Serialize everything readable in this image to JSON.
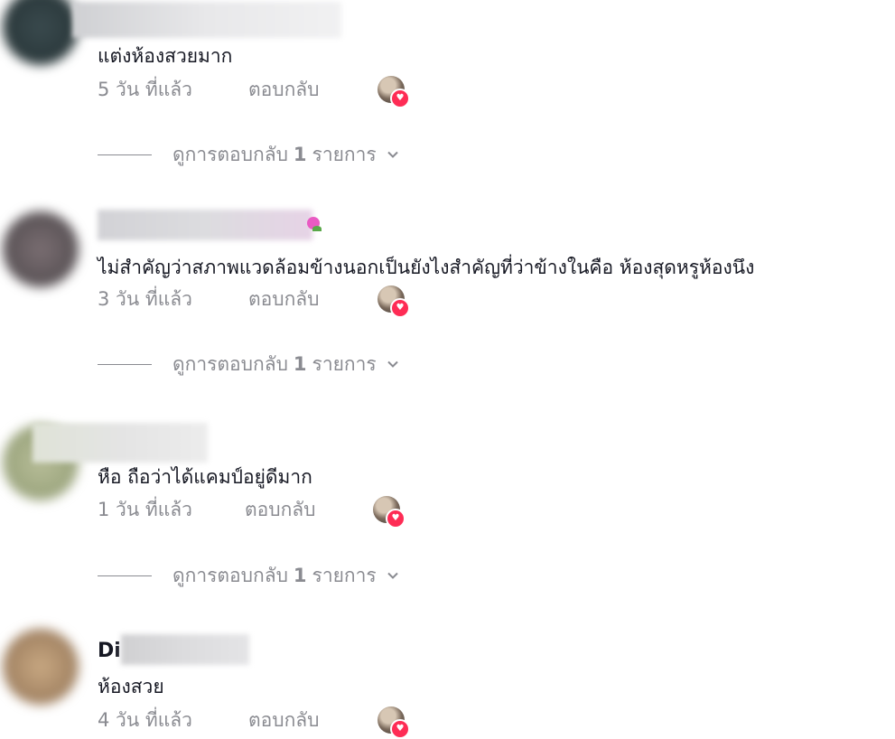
{
  "comments": [
    {
      "text": "แต่งห้องสวยมาก",
      "time": "5 วัน ที่แล้ว",
      "reply_label": "ตอบกลับ",
      "view_replies": {
        "prefix": "ดูการตอบกลับ",
        "count": "1",
        "suffix": "รายการ"
      }
    },
    {
      "text": "ไม่สำคัญว่าสภาพแวดล้อมข้างนอกเป็นยังไงสำคัญที่ว่าข้างในคือ ห้องสุดหรูห้องนึง",
      "time": "3 วัน ที่แล้ว",
      "reply_label": "ตอบกลับ",
      "view_replies": {
        "prefix": "ดูการตอบกลับ",
        "count": "1",
        "suffix": "รายการ"
      }
    },
    {
      "text": "หือ ถือว่าได้แคมป์อยู่ดีมาก",
      "time": "1 วัน ที่แล้ว",
      "reply_label": "ตอบกลับ",
      "view_replies": {
        "prefix": "ดูการตอบกลับ",
        "count": "1",
        "suffix": "รายการ"
      }
    },
    {
      "username_visible": "Di",
      "text": "ห้องสวย",
      "time": "4 วัน ที่แล้ว",
      "reply_label": "ตอบกลับ"
    }
  ],
  "icons": {
    "heart": "heart-icon",
    "chevron": "chevron-down-icon",
    "flower": "flower-emoji"
  },
  "colors": {
    "text": "#161823",
    "muted": "#8a8b91",
    "like": "#fe2c55"
  }
}
